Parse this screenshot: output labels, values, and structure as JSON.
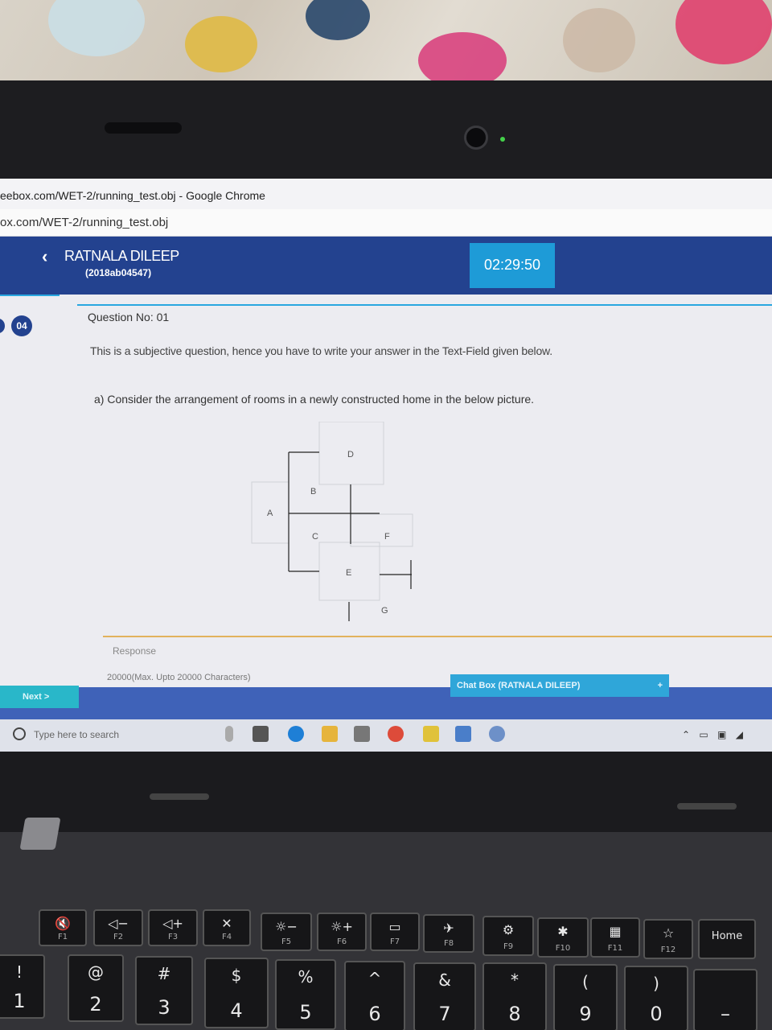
{
  "window": {
    "title": "eebox.com/WET-2/running_test.obj - Google Chrome",
    "url": "ox.com/WET-2/running_test.obj"
  },
  "header": {
    "user_name": "RATNALA DILEEP",
    "user_id": "(2018ab04547)",
    "timer": "02:29:50"
  },
  "nav": {
    "question_badge": "04",
    "next_label": "Next >"
  },
  "question": {
    "number": "Question No: 01",
    "hint": "This is a subjective question, hence you have to write your answer in the Text-Field given below.",
    "text": "a) Consider the arrangement of rooms in a newly constructed home in the below picture.",
    "rooms": [
      "A",
      "B",
      "C",
      "D",
      "E",
      "F",
      "G"
    ]
  },
  "response": {
    "label": "Response",
    "char_limit": "20000(Max. Upto 20000 Characters)"
  },
  "chat": {
    "label": "Chat Box (RATNALA DILEEP)",
    "expand": "+"
  },
  "taskbar": {
    "search_placeholder": "Type here to search"
  },
  "keyboard": {
    "fkeys": [
      "F1",
      "F2",
      "F3",
      "F4",
      "F5",
      "F6",
      "F7",
      "F8",
      "F9",
      "F10",
      "F11",
      "F12"
    ],
    "home": "Home",
    "digits_top": [
      "!",
      "@",
      "#",
      "$",
      "%",
      "^",
      "&",
      "*",
      "(",
      ")"
    ],
    "digits": [
      "1",
      "2",
      "3",
      "4",
      "5",
      "6",
      "7",
      "8",
      "9",
      "0"
    ]
  },
  "colors": {
    "header_blue": "#23428f",
    "timer_blue": "#1e9bd7",
    "accent_cyan": "#29a7e0",
    "response_line": "#e2b25c"
  }
}
